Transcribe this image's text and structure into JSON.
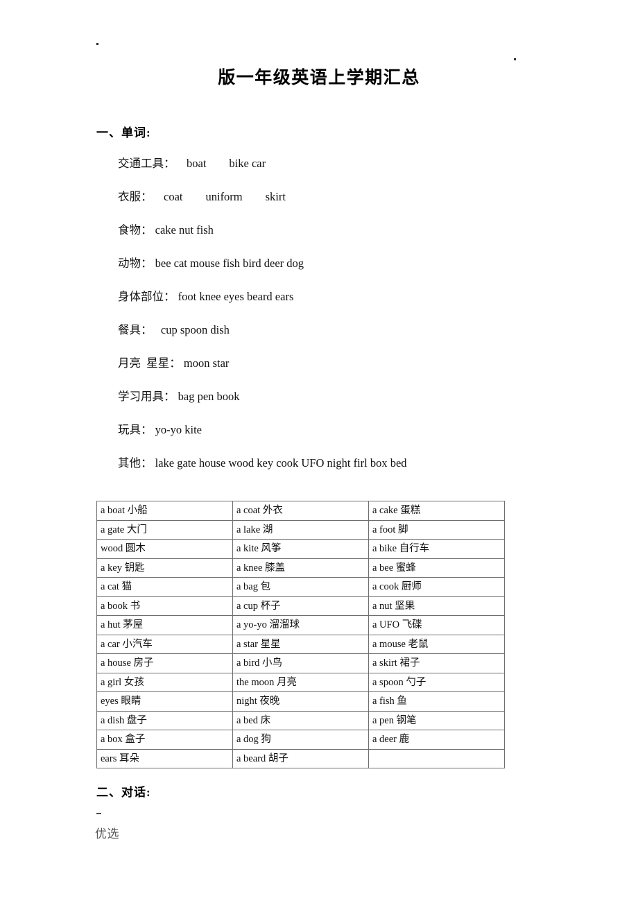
{
  "document": {
    "title": "版一年级英语上学期汇总"
  },
  "sections": {
    "words_heading": "一、单词:",
    "dialog_heading": "二、对话:"
  },
  "word_categories": [
    {
      "label": "交通工具：",
      "words": "    boat        bike car"
    },
    {
      "label": "衣服：",
      "words": "    coat        uniform        skirt"
    },
    {
      "label": "食物：",
      "words": " cake nut fish"
    },
    {
      "label": "动物：",
      "words": " bee cat mouse fish bird deer dog"
    },
    {
      "label": "身体部位：",
      "words": " foot knee eyes beard ears"
    },
    {
      "label": "餐具：",
      "words": "   cup spoon dish"
    },
    {
      "label": "月亮  星星：",
      "words": " moon star"
    },
    {
      "label": "学习用具：",
      "words": " bag pen book"
    },
    {
      "label": "玩具：",
      "words": " yo-yo kite"
    },
    {
      "label": "其他：",
      "words": " lake gate house wood key cook UFO night firl box bed"
    }
  ],
  "vocab_table": {
    "rows": [
      [
        "a boat  小船",
        "a coat  外衣",
        "a cake 蛋糕"
      ],
      [
        "a gate 大门",
        "a lake 湖",
        "a foot 脚"
      ],
      [
        "wood 圆木",
        "a kite 风筝",
        "a bike 自行车"
      ],
      [
        "a key 钥匙",
        "a knee 膝盖",
        "a bee 蜜蜂"
      ],
      [
        "a cat 猫",
        "a bag 包",
        "a cook 厨师"
      ],
      [
        "a book 书",
        "a cup 杯子",
        "a nut 坚果"
      ],
      [
        "a hut 茅屋",
        "a yo-yo 溜溜球",
        "a UFO 飞碟"
      ],
      [
        "a car 小汽车",
        "a star 星星",
        "a mouse 老鼠"
      ],
      [
        "a house 房子",
        "a bird 小鸟",
        "a skirt 裙子"
      ],
      [
        "a girl 女孩",
        "the moon 月亮",
        "a spoon 勺子"
      ],
      [
        "eyes 眼睛",
        "night 夜晚",
        "a fish 鱼"
      ],
      [
        "a dish 盘子",
        "a bed 床",
        "a pen 钢笔"
      ],
      [
        "a box 盒子",
        "a dog 狗",
        "a deer  鹿"
      ],
      [
        "ears 耳朵",
        "a beard 胡子",
        ""
      ]
    ]
  },
  "footer": {
    "mark": "优选"
  }
}
